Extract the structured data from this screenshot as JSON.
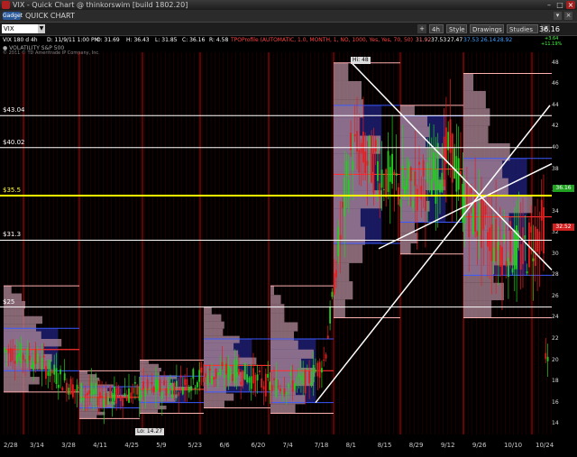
{
  "window": {
    "title": "VIX - Quick Chart @ thinkorswim [build 1802.20]",
    "sub_title": "QUICK CHART",
    "gadget_label": "Gadget"
  },
  "toolbar": {
    "symbol": "VIX",
    "aggregation": "4h",
    "style": "Style",
    "drawings": "Drawings",
    "studies": "Studies",
    "last_price": "36.16",
    "change": "+3.64",
    "change_pct": "+11.19%"
  },
  "infobar": {
    "symbol_period": "VIX 180 d 4h",
    "date_time": "D: 11/9/11 1:00 PM",
    "open": "O: 31.69",
    "high": "H: 36.43",
    "low": "L: 31.85",
    "close": "C: 36.16",
    "range": "R: 4.58",
    "study": "TPOProfile (AUTOMATIC, 1.0, MONTH, 1, NO, 1000, Yes, Yes, 70, 50)",
    "val1": "31.92",
    "val2": "37.53",
    "val3": "27.47",
    "val4": "37.53",
    "val5": "26.14",
    "val6": "28.92"
  },
  "subinfo": {
    "line1": "● VOLATILITY S&P 500",
    "line2": "© 2011 © TD Ameritrade IP Company, Inc."
  },
  "levels": [
    {
      "label": "$43.04",
      "price": 43.04,
      "color": "#ffffff"
    },
    {
      "label": "$40.02",
      "price": 40.02,
      "color": "#ffffff"
    },
    {
      "label": "$35.5",
      "price": 35.5,
      "color": "#ffff00"
    },
    {
      "label": "$31.3",
      "price": 31.3,
      "color": "#ffffff"
    },
    {
      "label": "$25",
      "price": 25,
      "color": "#ffffff"
    }
  ],
  "annotations": {
    "high": "Hi: 48",
    "low": "Lo: 14.27"
  },
  "y_axis": {
    "min": 13,
    "max": 49,
    "ticks": [
      "48",
      "46",
      "44",
      "42",
      "40",
      "38",
      "36",
      "34",
      "32",
      "30",
      "28",
      "26",
      "24",
      "22",
      "20",
      "18",
      "16",
      "14"
    ]
  },
  "x_axis": {
    "dates": [
      "2/28",
      "3/14",
      "3/28",
      "4/11",
      "4/25",
      "5/9",
      "5/23",
      "6/6",
      "6/20",
      "7/4",
      "7/18",
      "8/1",
      "8/15",
      "8/29",
      "9/12",
      "9/26",
      "10/10",
      "10/24"
    ]
  },
  "price_badges": [
    {
      "text": "36.16",
      "price": 36.16,
      "color": "#20a020"
    },
    {
      "text": "32.52",
      "price": 32.52,
      "color": "#d02020"
    }
  ],
  "colors": {
    "background": "#000000",
    "profile": "#b08a9a",
    "value_area": "#1c1c6a",
    "poc_line": "#3a5aff",
    "up_bar": "#20d020",
    "down_bar": "#e02020",
    "grid_vertical": "#5a0000",
    "month_line": "#c00000"
  }
}
